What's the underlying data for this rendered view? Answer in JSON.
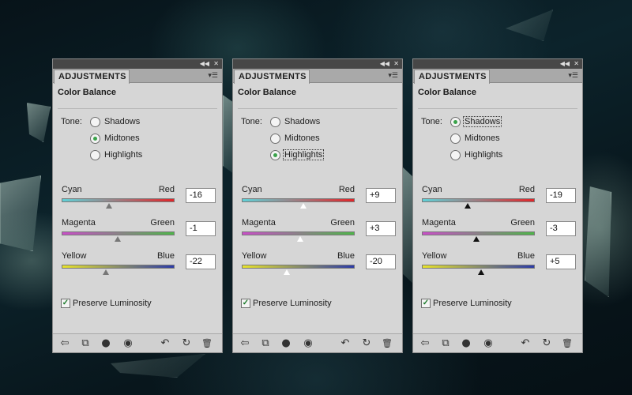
{
  "panels": [
    {
      "tab": "ADJUSTMENTS",
      "title": "Color Balance",
      "tone_label": "Tone:",
      "tones": [
        {
          "label": "Shadows",
          "checked": false,
          "focused": false
        },
        {
          "label": "Midtones",
          "checked": true,
          "focused": false
        },
        {
          "label": "Highlights",
          "checked": false,
          "focused": false
        }
      ],
      "sliders": [
        {
          "left": "Cyan",
          "right": "Red",
          "value": "-16",
          "level": -16,
          "thumb": "gray"
        },
        {
          "left": "Magenta",
          "right": "Green",
          "value": "-1",
          "level": -1,
          "thumb": "gray"
        },
        {
          "left": "Yellow",
          "right": "Blue",
          "value": "-22",
          "level": -22,
          "thumb": "gray"
        }
      ],
      "preserve_label": "Preserve Luminosity",
      "preserve_checked": true
    },
    {
      "tab": "ADJUSTMENTS",
      "title": "Color Balance",
      "tone_label": "Tone:",
      "tones": [
        {
          "label": "Shadows",
          "checked": false,
          "focused": false
        },
        {
          "label": "Midtones",
          "checked": false,
          "focused": false
        },
        {
          "label": "Highlights",
          "checked": true,
          "focused": true
        }
      ],
      "sliders": [
        {
          "left": "Cyan",
          "right": "Red",
          "value": "+9",
          "level": 9,
          "thumb": "white"
        },
        {
          "left": "Magenta",
          "right": "Green",
          "value": "+3",
          "level": 3,
          "thumb": "white"
        },
        {
          "left": "Yellow",
          "right": "Blue",
          "value": "-20",
          "level": -20,
          "thumb": "white"
        }
      ],
      "preserve_label": "Preserve Luminosity",
      "preserve_checked": true
    },
    {
      "tab": "ADJUSTMENTS",
      "title": "Color Balance",
      "tone_label": "Tone:",
      "tones": [
        {
          "label": "Shadows",
          "checked": true,
          "focused": true
        },
        {
          "label": "Midtones",
          "checked": false,
          "focused": false
        },
        {
          "label": "Highlights",
          "checked": false,
          "focused": false
        }
      ],
      "sliders": [
        {
          "left": "Cyan",
          "right": "Red",
          "value": "-19",
          "level": -19,
          "thumb": "black"
        },
        {
          "left": "Magenta",
          "right": "Green",
          "value": "-3",
          "level": -3,
          "thumb": "black"
        },
        {
          "left": "Yellow",
          "right": "Blue",
          "value": "+5",
          "level": 5,
          "thumb": "black"
        }
      ],
      "preserve_label": "Preserve Luminosity",
      "preserve_checked": true
    }
  ],
  "slider_gradients": [
    [
      "#5fd0d6",
      "#e0262a"
    ],
    [
      "#c84fc7",
      "#4fb54a"
    ],
    [
      "#e8e32a",
      "#2c3ba8"
    ]
  ],
  "slider_range": [
    -100,
    100
  ],
  "toolbar_icons": [
    "back-arrow-icon",
    "clip-to-layer-icon",
    "layer-visibility-dot-icon",
    "eye-icon",
    "previous-state-icon",
    "reset-icon",
    "trash-icon"
  ],
  "colors": {
    "panel_bg": "#d6d6d6",
    "radio_checked": "#3aa24a"
  }
}
